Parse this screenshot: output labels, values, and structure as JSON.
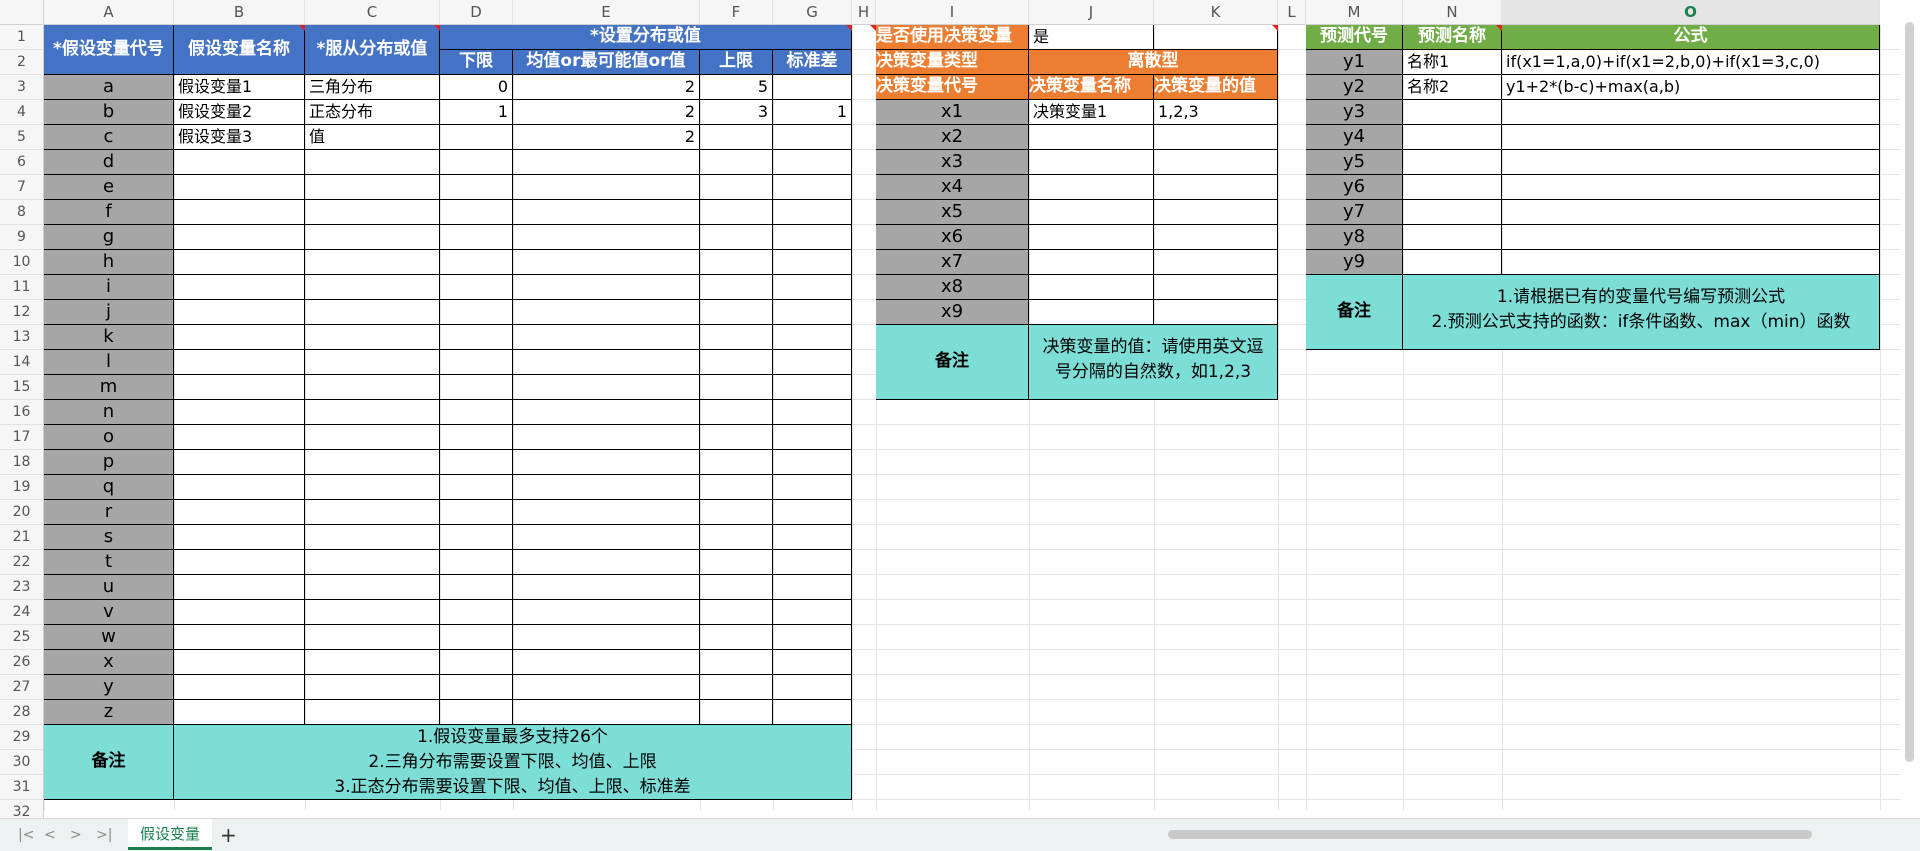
{
  "columns": [
    "A",
    "B",
    "C",
    "D",
    "E",
    "F",
    "G",
    "H",
    "I",
    "J",
    "K",
    "L",
    "M",
    "N",
    "O"
  ],
  "rows": [
    "1",
    "2",
    "3",
    "4",
    "5",
    "6",
    "7",
    "8",
    "9",
    "10",
    "11",
    "12",
    "13",
    "14",
    "15",
    "16",
    "17",
    "18",
    "19",
    "20",
    "21",
    "22",
    "23",
    "24",
    "25",
    "26",
    "27",
    "28",
    "29",
    "30",
    "31",
    "32"
  ],
  "table1": {
    "headers": {
      "code": "*假设变量代号",
      "name": "假设变量名称",
      "dist": "*服从分布或值",
      "group": "*设置分布或值",
      "lower": "下限",
      "mean": "均值or最可能值or值",
      "upper": "上限",
      "std": "标准差"
    },
    "codes": [
      "a",
      "b",
      "c",
      "d",
      "e",
      "f",
      "g",
      "h",
      "i",
      "j",
      "k",
      "l",
      "m",
      "n",
      "o",
      "p",
      "q",
      "r",
      "s",
      "t",
      "u",
      "v",
      "w",
      "x",
      "y",
      "z"
    ],
    "rows": [
      {
        "name": "假设变量1",
        "dist": "三角分布",
        "lower": "0",
        "mean": "2",
        "upper": "5",
        "std": ""
      },
      {
        "name": "假设变量2",
        "dist": "正态分布",
        "lower": "1",
        "mean": "2",
        "upper": "3",
        "std": "1"
      },
      {
        "name": "假设变量3",
        "dist": "值",
        "lower": "",
        "mean": "2",
        "upper": "",
        "std": ""
      }
    ],
    "note_label": "备注",
    "note_text": "1.假设变量最多支持26个\n2.三角分布需要设置下限、均值、上限\n3.正态分布需要设置下限、均值、上限、标准差"
  },
  "table2": {
    "use_label": "是否使用决策变量",
    "use_value": "是",
    "type_label": "决策变量类型",
    "type_value": "离散型",
    "headers": {
      "code": "决策变量代号",
      "name": "决策变量名称",
      "value": "决策变量的值"
    },
    "codes": [
      "x1",
      "x2",
      "x3",
      "x4",
      "x5",
      "x6",
      "x7",
      "x8",
      "x9"
    ],
    "rows": [
      {
        "name": "决策变量1",
        "value": "1,2,3"
      }
    ],
    "note_label": "备注",
    "note_text": "决策变量的值：请使用英文逗\n号分隔的自然数，如1,2,3"
  },
  "table3": {
    "headers": {
      "code": "预测代号",
      "name": "预测名称",
      "formula": "公式"
    },
    "codes": [
      "y1",
      "y2",
      "y3",
      "y4",
      "y5",
      "y6",
      "y7",
      "y8",
      "y9"
    ],
    "rows": [
      {
        "name": "名称1",
        "formula": "if(x1=1,a,0)+if(x1=2,b,0)+if(x1=3,c,0)"
      },
      {
        "name": "名称2",
        "formula": "y1+2*(b-c)+max(a,b)"
      }
    ],
    "note_label": "备注",
    "note_text": "1.请根据已有的变量代号编写预测公式\n2.预测公式支持的函数：if条件函数、max（min）函数"
  },
  "sheet_tabs": [
    "假设变量"
  ],
  "add_sheet": "+",
  "nav_buttons": [
    "|<",
    "<",
    ">",
    ">|"
  ],
  "colors": {
    "blue": "#4472c4",
    "orange": "#ed7d31",
    "green": "#70ad47",
    "gray": "#a6a6a6",
    "teal": "#7dddd7",
    "tab_active": "#1b7e4c"
  }
}
